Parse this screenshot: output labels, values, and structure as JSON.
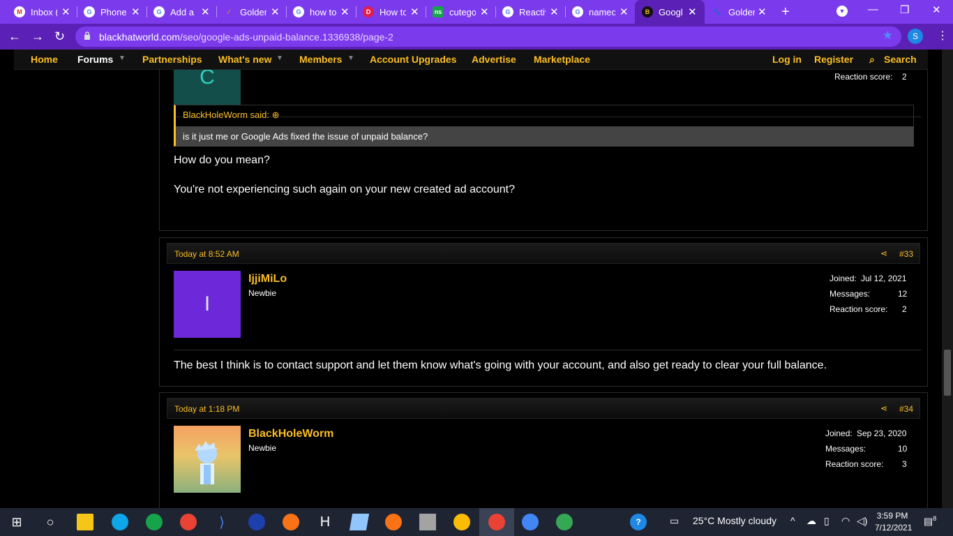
{
  "browser": {
    "tabs": [
      {
        "title": "Inbox (",
        "favicon": "gmail-icon"
      },
      {
        "title": "Phone",
        "favicon": "google-icon"
      },
      {
        "title": "Add a",
        "favicon": "google-icon"
      },
      {
        "title": "Golden",
        "favicon": "ranker-icon"
      },
      {
        "title": "how to",
        "favicon": "google-icon"
      },
      {
        "title": "How to",
        "favicon": "pinterest-icon"
      },
      {
        "title": "cutego",
        "favicon": "namesilo-icon"
      },
      {
        "title": "Reactiv",
        "favicon": "google-icon"
      },
      {
        "title": "namec",
        "favicon": "google-icon"
      },
      {
        "title": "Googl",
        "favicon": "bhw-icon"
      },
      {
        "title": "Golden",
        "favicon": "paw-icon"
      }
    ],
    "url_domain": "blackhatworld.com",
    "url_path": "/seo/google-ads-unpaid-balance.1336938/page-2",
    "profile_initial": "S"
  },
  "site_nav": {
    "items": [
      "Home",
      "Forums",
      "Partnerships",
      "What's new",
      "Members",
      "Account Upgrades",
      "Advertise",
      "Marketplace"
    ],
    "login": "Log in",
    "register": "Register",
    "search": "Search"
  },
  "post_top": {
    "reaction_label": "Reaction score:",
    "reaction_value": "2",
    "avatar_letter": "C",
    "quote_author": "BlackHoleWorm said:",
    "quote_text": "is it just me or Google Ads fixed the issue of unpaid balance?",
    "body_line1": "How do you mean?",
    "body_line2": "You're not experiencing such again on your new created ad account?"
  },
  "post_33": {
    "date": "Today at 8:52 AM",
    "number": "#33",
    "avatar_letter": "I",
    "username": "IjjiMiLo",
    "user_title": "Newbie",
    "joined_label": "Joined:",
    "joined_value": "Jul 12, 2021",
    "messages_label": "Messages:",
    "messages_value": "12",
    "reaction_label": "Reaction score:",
    "reaction_value": "2",
    "body": "The best I think is to contact support and let them know what's going with your account, and also get ready to clear your full balance."
  },
  "post_34": {
    "date": "Today at 1:18 PM",
    "number": "#34",
    "username": "BlackHoleWorm",
    "user_title": "Newbie",
    "joined_label": "Joined:",
    "joined_value": "Sep 23, 2020",
    "messages_label": "Messages:",
    "messages_value": "10",
    "reaction_label": "Reaction score:",
    "reaction_value": "3"
  },
  "taskbar": {
    "weather": "25°C  Mostly cloudy",
    "time": "3:59 PM",
    "date": "7/12/2021",
    "notification_count": "8"
  },
  "colors": {
    "accent": "#fbbf24",
    "chrome": "#7c3aed"
  }
}
